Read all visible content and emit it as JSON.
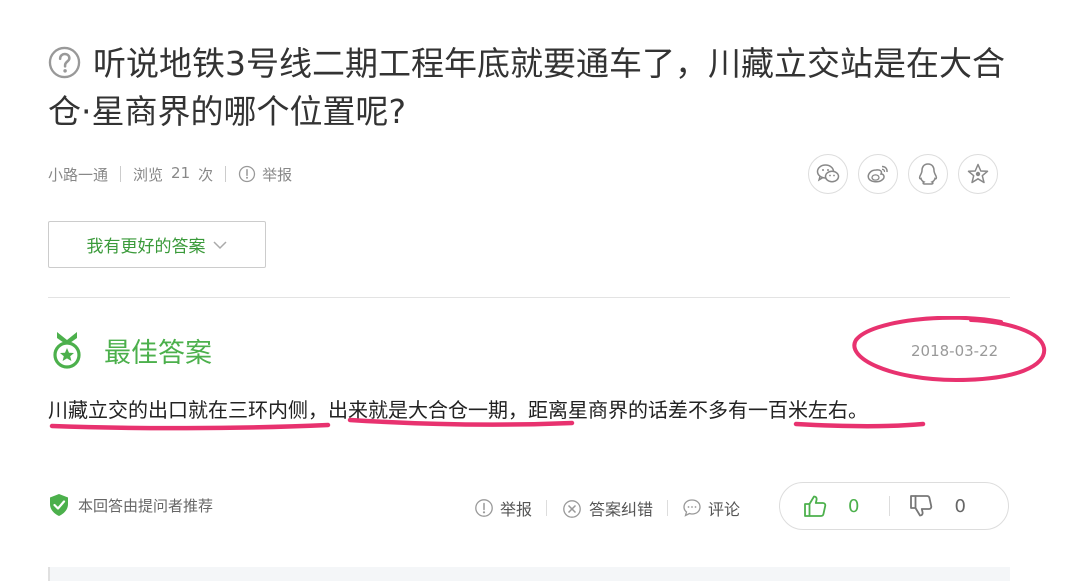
{
  "question": {
    "title": "听说地铁3号线二期工程年底就要通车了，川藏立交站是在大合仓·星商界的哪个位置呢?",
    "author": "小路一通",
    "views_label": "浏览",
    "views_count": "21",
    "views_unit": "次",
    "report_label": "举报"
  },
  "share": {
    "items": [
      "wechat-icon",
      "weibo-icon",
      "qq-icon",
      "favorite-icon"
    ]
  },
  "better_answer_button": "我有更好的答案",
  "best_answer": {
    "heading": "最佳答案",
    "date": "2018-03-22",
    "text": "川藏立交的出口就在三环内侧，出来就是大合仓一期，距离星商界的话差不多有一百米左右。"
  },
  "footer": {
    "recommend_text": "本回答由提问者推荐",
    "report_label": "举报",
    "correct_label": "答案纠错",
    "comment_label": "评论",
    "upvotes": "0",
    "downvotes": "0"
  },
  "colors": {
    "accent_green": "#4cb04c",
    "annotation_pink": "#e8326f"
  }
}
